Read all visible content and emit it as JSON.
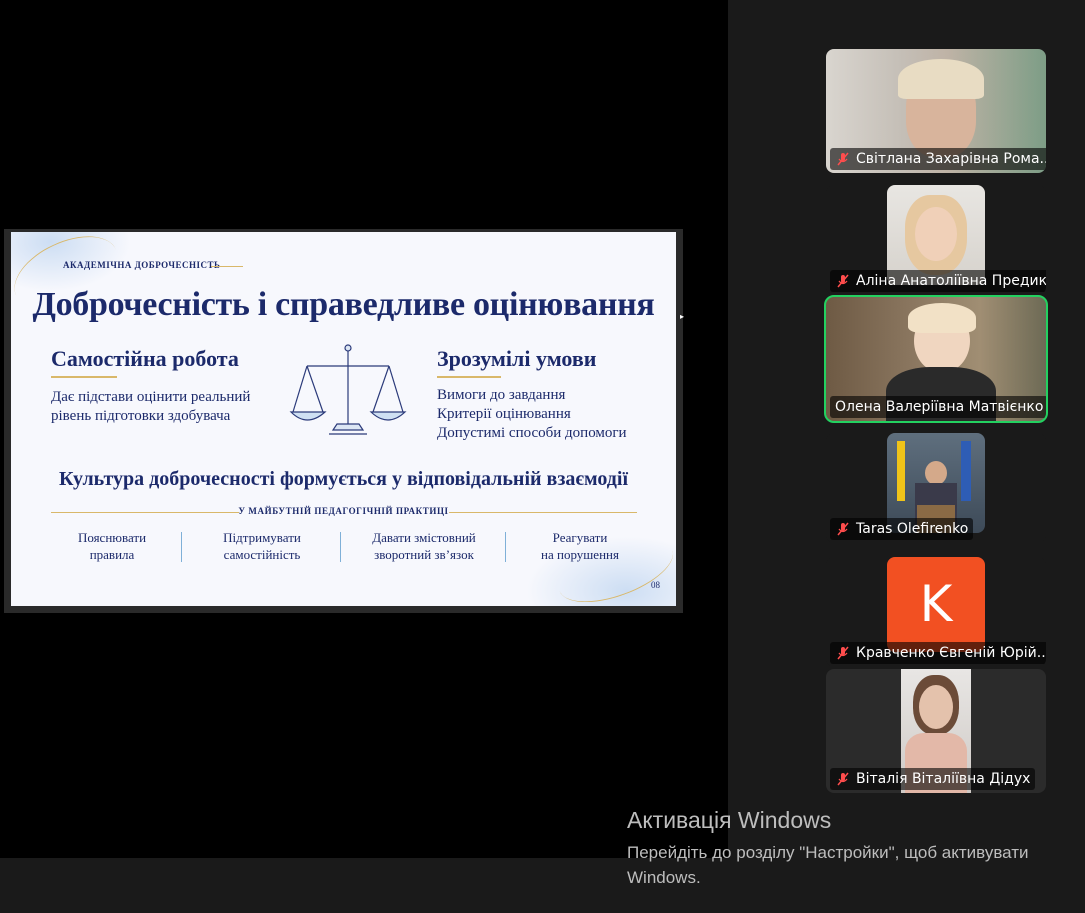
{
  "slide": {
    "eyebrow": "АКАДЕМІЧНА ДОБРОЧЕСНІСТЬ",
    "title": "Доброчесність і справедливе оцінювання",
    "left_heading": "Самостійна робота",
    "left_text_1": "Дає підстави оцінити реальний",
    "left_text_2": "рівень підготовки здобувача",
    "right_heading": "Зрозумілі умови",
    "right_items": [
      "Вимоги до завдання",
      "Критерії оцінювання",
      "Допустимі способи допомоги"
    ],
    "culture": "Культура доброчесності формується у відповідальній взаємодії",
    "subcaption": "У МАЙБУТНІЙ ПЕДАГОГІЧНІЙ ПРАКТИЦІ",
    "actions": [
      {
        "l1": "Пояснювати",
        "l2": "правила"
      },
      {
        "l1": "Підтримувати",
        "l2": "самостійність"
      },
      {
        "l1": "Давати змістовний",
        "l2": "зворотний зв’язок"
      },
      {
        "l1": "Реагувати",
        "l2": "на порушення"
      }
    ],
    "page_number": "08"
  },
  "participants": [
    {
      "name": "Світлана Захарівна Рома...",
      "muted": true
    },
    {
      "name": "Аліна Анатоліївна Предик",
      "muted": true
    },
    {
      "name": "Олена Валеріївна Матвієнко",
      "muted": false,
      "active": true
    },
    {
      "name": "Taras Olefirenko",
      "muted": true
    },
    {
      "name": "Кравченко Євгеній Юрій...",
      "muted": true,
      "avatar_letter": "K"
    },
    {
      "name": "Віталія Віталіївна Дідух",
      "muted": true
    }
  ],
  "windows_activation": {
    "title": "Активація Windows",
    "subtitle": "Перейдіть до розділу \"Настройки\", щоб активувати Windows."
  },
  "colors": {
    "active_speaker": "#23d160",
    "avatar_k": "#f25022",
    "slide_navy": "#1c2a6b",
    "slide_gold": "#d9b86a"
  }
}
